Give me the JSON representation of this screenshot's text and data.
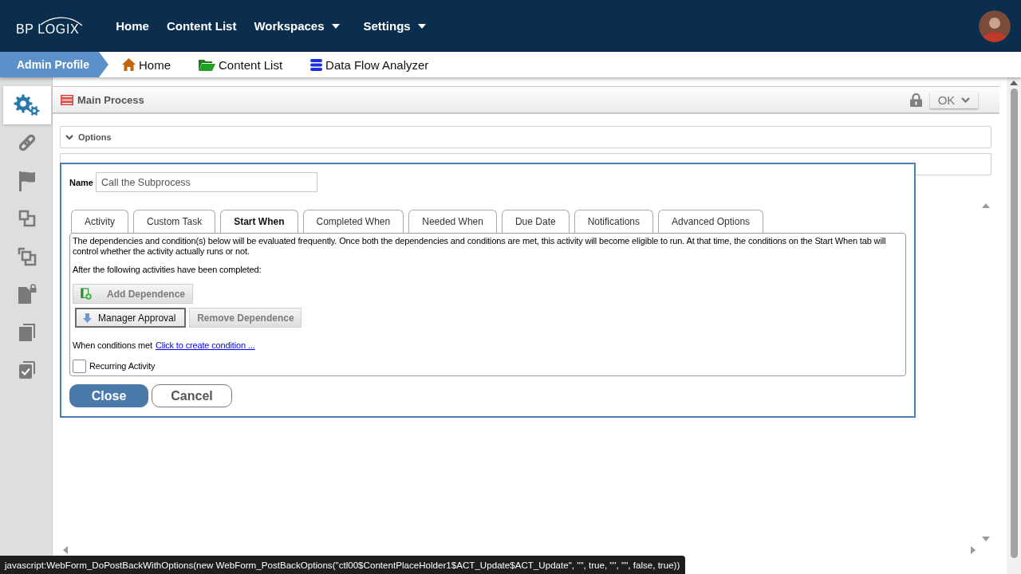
{
  "top_nav": {
    "logo": "BP LOGIX",
    "items": [
      {
        "label": "Home",
        "dropdown": false
      },
      {
        "label": "Content List",
        "dropdown": false
      },
      {
        "label": "Workspaces",
        "dropdown": true
      },
      {
        "label": "Settings",
        "dropdown": true
      }
    ]
  },
  "breadcrumb": {
    "profile": "Admin Profile",
    "links": [
      {
        "label": "Home",
        "kind": "home"
      },
      {
        "label": "Content List",
        "kind": "folder"
      },
      {
        "label": "Data Flow Analyzer",
        "kind": "database"
      }
    ]
  },
  "sidebar": {
    "items": [
      {
        "kind": "gears",
        "selected": true
      },
      {
        "kind": "link",
        "selected": false
      },
      {
        "kind": "flag",
        "selected": false
      },
      {
        "kind": "squares",
        "selected": false
      },
      {
        "kind": "overlap",
        "selected": false
      },
      {
        "kind": "doc-lock",
        "selected": false
      },
      {
        "kind": "copies",
        "selected": false
      },
      {
        "kind": "checklist",
        "selected": false
      }
    ]
  },
  "panel": {
    "title": "Main Process",
    "ok_button": "OK",
    "sections": [
      {
        "label": "Options"
      }
    ]
  },
  "dialog": {
    "name_label": "Name",
    "name_value": "Call the Subprocess",
    "tabs": [
      {
        "label": "Activity",
        "selected": false
      },
      {
        "label": "Custom Task",
        "selected": false
      },
      {
        "label": "Start When",
        "selected": true
      },
      {
        "label": "Completed When",
        "selected": false
      },
      {
        "label": "Needed When",
        "selected": false
      },
      {
        "label": "Due Date",
        "selected": false
      },
      {
        "label": "Notifications",
        "selected": false
      },
      {
        "label": "Advanced Options",
        "selected": false
      }
    ],
    "intro": "The dependencies and condition(s) below will be evaluated frequently. Once both the dependencies and conditions are met, this activity will become eligible to run. At that time, the conditions on the Start When tab will control whether the activity actually runs or not.",
    "after_label": "After the following activities have been completed:",
    "add_button": {
      "label": "Add Dependence",
      "disabled": true
    },
    "dependencies": [
      {
        "label": "Manager Approval",
        "selected": true
      }
    ],
    "remove_button": {
      "label": "Remove Dependence",
      "disabled": true
    },
    "conditions_label": "When conditions met",
    "conditions_link": "Click to create condition ...",
    "recurring": {
      "label": "Recurring Activity",
      "checked": false
    },
    "buttons": [
      {
        "label": "Close",
        "kind": "primary"
      },
      {
        "label": "Cancel",
        "kind": "secondary"
      }
    ]
  },
  "status_bar": "javascript:WebForm_DoPostBackWithOptions(new WebForm_PostBackOptions(\"ctl00$ContentPlaceHolder1$ACT_Update$ACT_Update\", \"\", true, \"\", \"\", false, true))"
}
